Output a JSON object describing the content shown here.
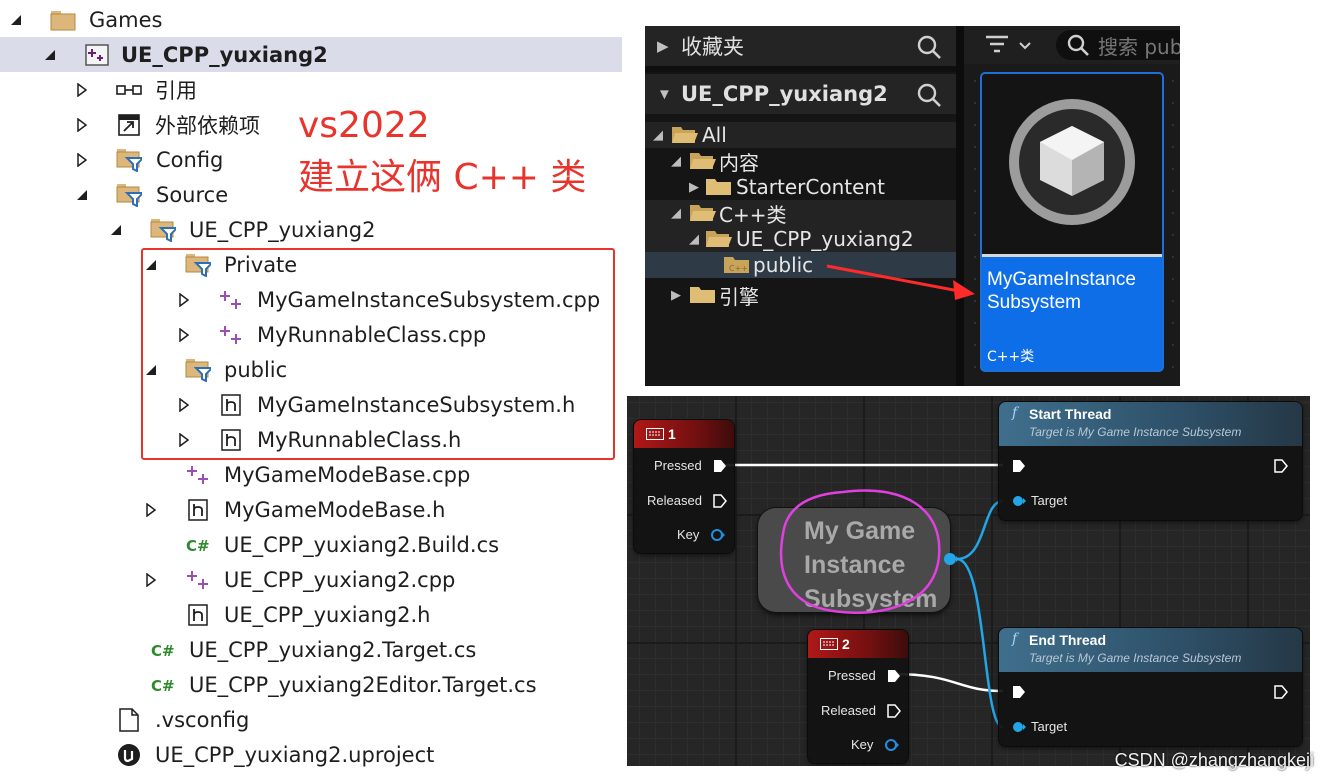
{
  "explorer": {
    "rows": [
      {
        "label": "Games"
      },
      {
        "label": "UE_CPP_yuxiang2"
      },
      {
        "label": "引用"
      },
      {
        "label": "外部依赖项"
      },
      {
        "label": "Config"
      },
      {
        "label": "Source"
      },
      {
        "label": "UE_CPP_yuxiang2"
      },
      {
        "label": "Private"
      },
      {
        "label": "MyGameInstanceSubsystem.cpp"
      },
      {
        "label": "MyRunnableClass.cpp"
      },
      {
        "label": "public"
      },
      {
        "label": "MyGameInstanceSubsystem.h"
      },
      {
        "label": "MyRunnableClass.h"
      },
      {
        "label": "MyGameModeBase.cpp"
      },
      {
        "label": "MyGameModeBase.h"
      },
      {
        "label": "UE_CPP_yuxiang2.Build.cs"
      },
      {
        "label": "UE_CPP_yuxiang2.cpp"
      },
      {
        "label": "UE_CPP_yuxiang2.h"
      },
      {
        "label": "UE_CPP_yuxiang2.Target.cs"
      },
      {
        "label": "UE_CPP_yuxiang2Editor.Target.cs"
      },
      {
        "label": ".vsconfig"
      },
      {
        "label": "UE_CPP_yuxiang2.uproject"
      }
    ],
    "annotation_line1": "vs2022",
    "annotation_line2": "建立这俩 C++ 类",
    "annotation_color": "#e8342c"
  },
  "content_browser": {
    "favorites": "收藏夹",
    "project": "UE_CPP_yuxiang2",
    "search_placeholder": "搜索 pub",
    "tree": [
      {
        "label": "All"
      },
      {
        "label": "内容"
      },
      {
        "label": "StarterContent"
      },
      {
        "label": "C++类"
      },
      {
        "label": "UE_CPP_yuxiang2"
      },
      {
        "label": "public"
      },
      {
        "label": "引擎"
      }
    ],
    "asset": {
      "name": "MyGameInstance Subsystem",
      "type": "C++类"
    },
    "accent": "#0d6ee8"
  },
  "blueprint": {
    "key1": {
      "title": "1",
      "pressed": "Pressed",
      "released": "Released",
      "key": "Key"
    },
    "key2": {
      "title": "2",
      "pressed": "Pressed",
      "released": "Released",
      "key": "Key"
    },
    "start_thread": {
      "title": "Start Thread",
      "subtitle": "Target is My Game Instance Subsystem",
      "target": "Target"
    },
    "end_thread": {
      "title": "End Thread",
      "subtitle": "Target is My Game Instance Subsystem",
      "target": "Target"
    },
    "object_node": {
      "line1": "My Game",
      "line2": "Instance",
      "line3": "Subsystem"
    }
  },
  "watermark": "CSDN @zhangzhangkeji"
}
